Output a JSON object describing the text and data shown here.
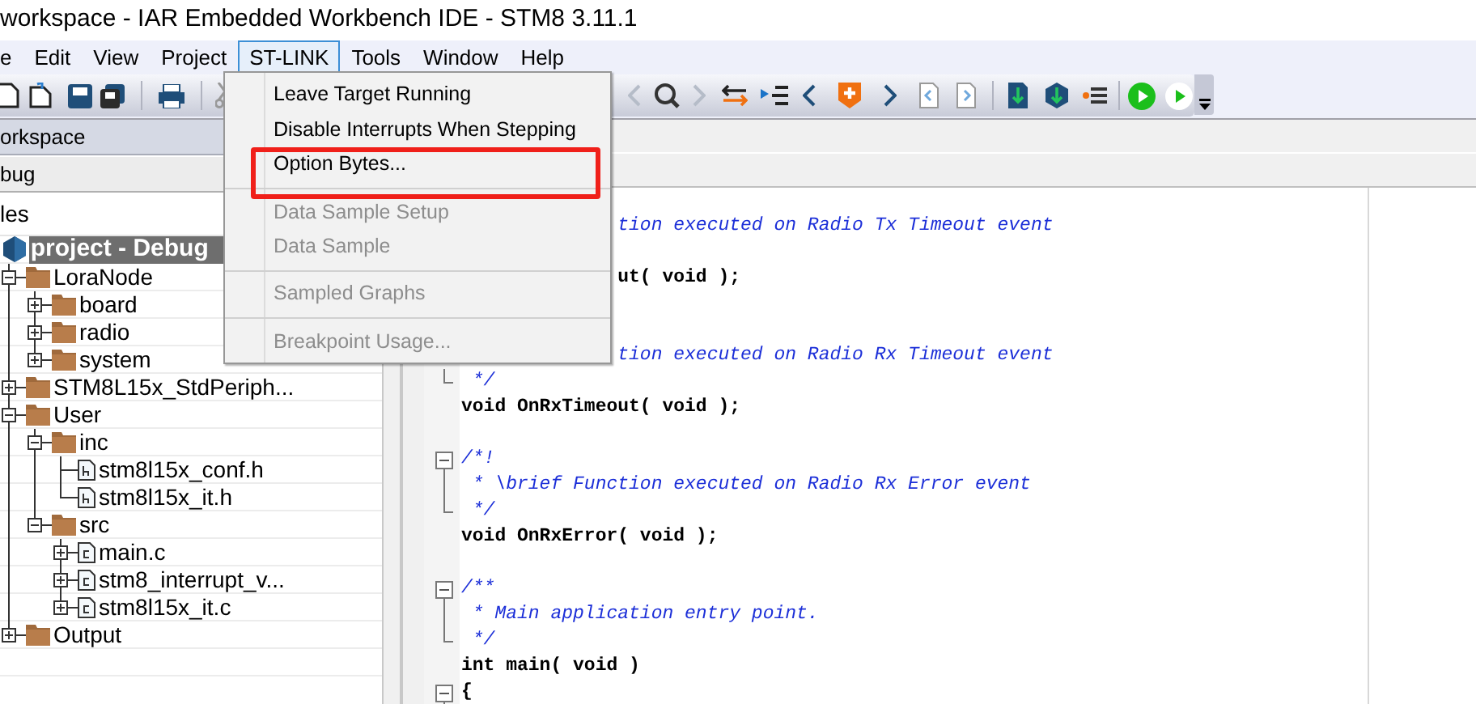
{
  "window": {
    "title": "workspace - IAR Embedded Workbench IDE - STM8 3.11.1"
  },
  "menu_bar": [
    {
      "label": "e",
      "selected": false
    },
    {
      "label": "Edit",
      "selected": false
    },
    {
      "label": "View",
      "selected": false
    },
    {
      "label": "Project",
      "selected": false
    },
    {
      "label": "ST-LINK",
      "selected": true
    },
    {
      "label": "Tools",
      "selected": false
    },
    {
      "label": "Window",
      "selected": false
    },
    {
      "label": "Help",
      "selected": false
    }
  ],
  "open_menu": {
    "items": [
      {
        "label": "Leave Target Running",
        "disabled": false,
        "outlined": false,
        "separator_after": false
      },
      {
        "label": "Disable Interrupts When Stepping",
        "disabled": false,
        "outlined": false,
        "separator_after": false
      },
      {
        "label": "Option Bytes...",
        "disabled": false,
        "outlined": true,
        "separator_after": true
      },
      {
        "label": "Data Sample Setup",
        "disabled": true,
        "outlined": false,
        "separator_after": false
      },
      {
        "label": "Data Sample",
        "disabled": true,
        "outlined": false,
        "separator_after": true
      },
      {
        "label": "Sampled Graphs",
        "disabled": true,
        "outlined": false,
        "separator_after": true
      },
      {
        "label": "Breakpoint Usage...",
        "disabled": true,
        "outlined": false,
        "separator_after": false
      }
    ]
  },
  "workspace": {
    "title": "orkspace",
    "configuration": "bug",
    "column_header": "les",
    "tree": [
      {
        "label": "project - Debug",
        "kind": "project",
        "selected": true,
        "children": [
          {
            "label": "LoraNode",
            "kind": "folder",
            "selected": false,
            "expanded": true,
            "children": [
              {
                "label": "board",
                "kind": "folder",
                "selected": false,
                "expanded": false
              },
              {
                "label": "radio",
                "kind": "folder",
                "selected": false,
                "expanded": false
              },
              {
                "label": "system",
                "kind": "folder",
                "selected": false,
                "expanded": false
              }
            ]
          },
          {
            "label": "STM8L15x_StdPeriph...",
            "kind": "folder",
            "selected": false,
            "expanded": false
          },
          {
            "label": "User",
            "kind": "folder",
            "selected": false,
            "expanded": true,
            "children": [
              {
                "label": "inc",
                "kind": "folder",
                "selected": false,
                "expanded": true,
                "children": [
                  {
                    "label": "stm8l15x_conf.h",
                    "kind": "header",
                    "selected": false
                  },
                  {
                    "label": "stm8l15x_it.h",
                    "kind": "header",
                    "selected": false
                  }
                ]
              },
              {
                "label": "src",
                "kind": "folder",
                "selected": false,
                "expanded": true,
                "children": [
                  {
                    "label": "main.c",
                    "kind": "source",
                    "selected": false,
                    "expanded": false
                  },
                  {
                    "label": "stm8_interrupt_v...",
                    "kind": "source",
                    "selected": false,
                    "expanded": false
                  },
                  {
                    "label": "stm8l15x_it.c",
                    "kind": "source",
                    "selected": false,
                    "expanded": false
                  }
                ]
              }
            ]
          },
          {
            "label": "Output",
            "kind": "folder",
            "selected": false,
            "expanded": false
          }
        ]
      }
    ]
  },
  "editor": {
    "lines": [
      {
        "kind": "blank"
      },
      {
        "kind": "partial-comment",
        "text": "tion executed on Radio Tx Timeout event"
      },
      {
        "kind": "blank"
      },
      {
        "kind": "partial-code",
        "text": "ut( void );"
      },
      {
        "kind": "blank"
      },
      {
        "kind": "blank"
      },
      {
        "kind": "partial-comment",
        "text": "tion executed on Radio Rx Timeout event"
      },
      {
        "kind": "comment",
        "text": " */",
        "fold_end": true
      },
      {
        "kind": "code",
        "text": "void OnRxTimeout( void );"
      },
      {
        "kind": "blank"
      },
      {
        "kind": "comment",
        "text": "/*!",
        "fold_start": true
      },
      {
        "kind": "comment",
        "text": " * \\brief Function executed on Radio Rx Error event",
        "in_fold": true
      },
      {
        "kind": "comment",
        "text": " */",
        "fold_end": true
      },
      {
        "kind": "code",
        "text": "void OnRxError( void );"
      },
      {
        "kind": "blank"
      },
      {
        "kind": "comment",
        "text": "/**",
        "fold_start": true
      },
      {
        "kind": "comment",
        "text": " * Main application entry point.",
        "in_fold": true
      },
      {
        "kind": "comment",
        "text": " */",
        "fold_end": true
      },
      {
        "kind": "code",
        "text": "int main( void )"
      },
      {
        "kind": "code",
        "text": "{",
        "fold_start": true
      }
    ]
  }
}
